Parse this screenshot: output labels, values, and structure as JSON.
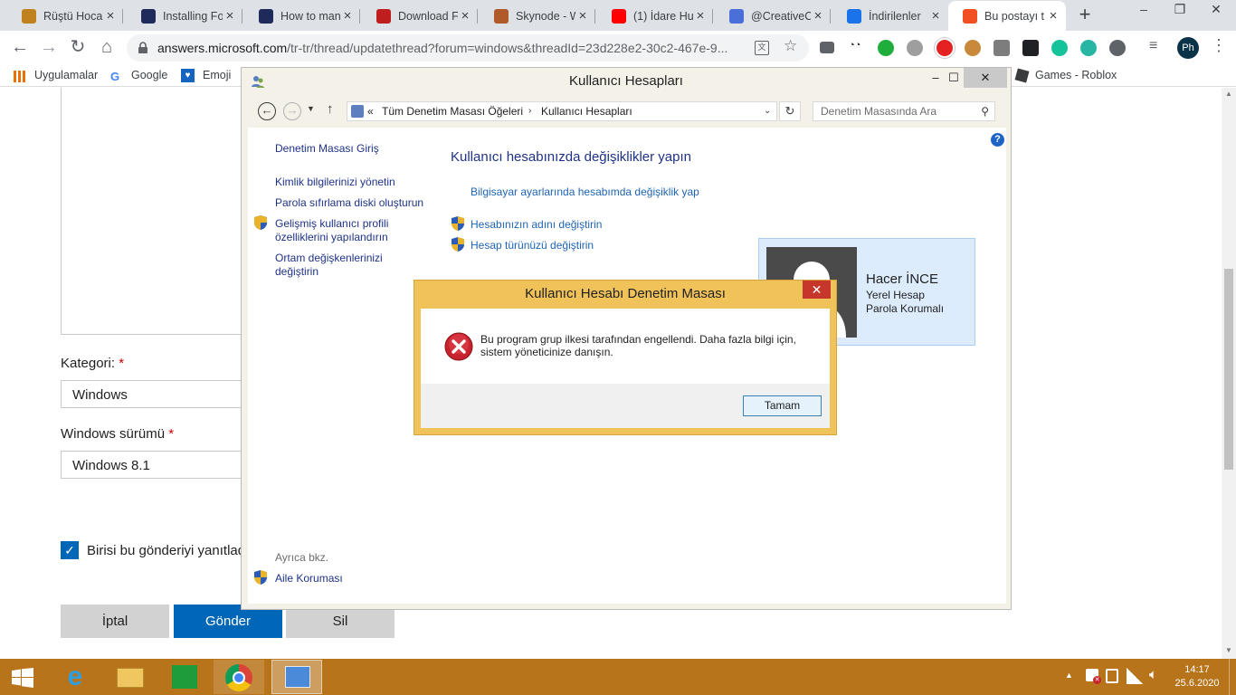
{
  "browser": {
    "tabs": [
      {
        "title": "Rüştü Hoca Y",
        "favicon": "quill-icon",
        "color": "#c0821e"
      },
      {
        "title": "Installing Fo",
        "favicon": "site-icon",
        "color": "#1e2a5a"
      },
      {
        "title": "How to man",
        "favicon": "site-icon",
        "color": "#1e2a5a"
      },
      {
        "title": "Download Fi",
        "favicon": "filezilla-icon",
        "color": "#bf1e1e"
      },
      {
        "title": "Skynode - W",
        "favicon": "skynode-icon",
        "color": "#b05a2a"
      },
      {
        "title": "(1) İdare Hu",
        "favicon": "youtube-icon",
        "color": "#ff0000"
      },
      {
        "title": "@CreativeCr",
        "favicon": "calendar-icon",
        "color": "#4a6fd8"
      },
      {
        "title": "İndirilenler",
        "favicon": "download-icon",
        "color": "#1a73e8"
      },
      {
        "title": "Bu postayı t",
        "favicon": "microsoft-icon",
        "color": "#f25022"
      }
    ],
    "active_tab_index": 8,
    "window_controls": [
      "–",
      "❐",
      "✕"
    ],
    "url_host": "answers.microsoft.com",
    "url_path": "/tr-tr/thread/updatethread?forum=windows&threadId=23d228e2-30c2-467e-9...",
    "profile_initials": "Ph",
    "bookmarks": [
      "Uygulamalar",
      "Google",
      "Emoji",
      "Games - Roblox"
    ]
  },
  "page": {
    "kategori_label": "Kategori:",
    "kategori_value": "Windows",
    "surum_label": "Windows sürümü",
    "surum_value": "Windows 8.1",
    "required_mark": "*",
    "notify_label": "Birisi bu gönderiyi yanıtlad",
    "buttons": {
      "cancel": "İptal",
      "submit": "Gönder",
      "delete": "Sil"
    }
  },
  "control_panel": {
    "title": "Kullanıcı Hesapları",
    "breadcrumb_prefix": "«",
    "breadcrumb": [
      "Tüm Denetim Masası Öğeleri",
      "Kullanıcı Hesapları"
    ],
    "search_placeholder": "Denetim Masasında Ara",
    "help": "?",
    "left_links": {
      "home": "Denetim Masası Giriş",
      "credentials": "Kimlik bilgilerinizi yönetin",
      "reset_disk": "Parola sıfırlama diski oluşturun",
      "advanced_line1": "Gelişmiş kullanıcı profili",
      "advanced_line2": "özelliklerini yapılandırın",
      "env_line1": "Ortam değişkenlerinizi",
      "env_line2": "değiştirin"
    },
    "see_also": "Ayrıca bkz.",
    "family": "Aile Koruması",
    "heading": "Kullanıcı hesabınızda değişiklikler yapın",
    "pc_settings_link": "Bilgisayar ayarlarında hesabımda değişiklik yap",
    "rename_link": "Hesabınızın adını değiştirin",
    "type_link": "Hesap türünüzü değiştirin",
    "user": {
      "name": "Hacer İNCE",
      "type": "Yerel Hesap",
      "protection": "Parola Korumalı"
    }
  },
  "uac_dialog": {
    "title": "Kullanıcı Hesabı Denetim Masası",
    "close": "✕",
    "message_line1": "Bu program grup ilkesi tarafından engellendi. Daha fazla bilgi için,",
    "message_line2": "sistem yöneticinize danışın.",
    "ok": "Tamam"
  },
  "taskbar": {
    "time": "14:17",
    "date": "25.6.2020"
  }
}
